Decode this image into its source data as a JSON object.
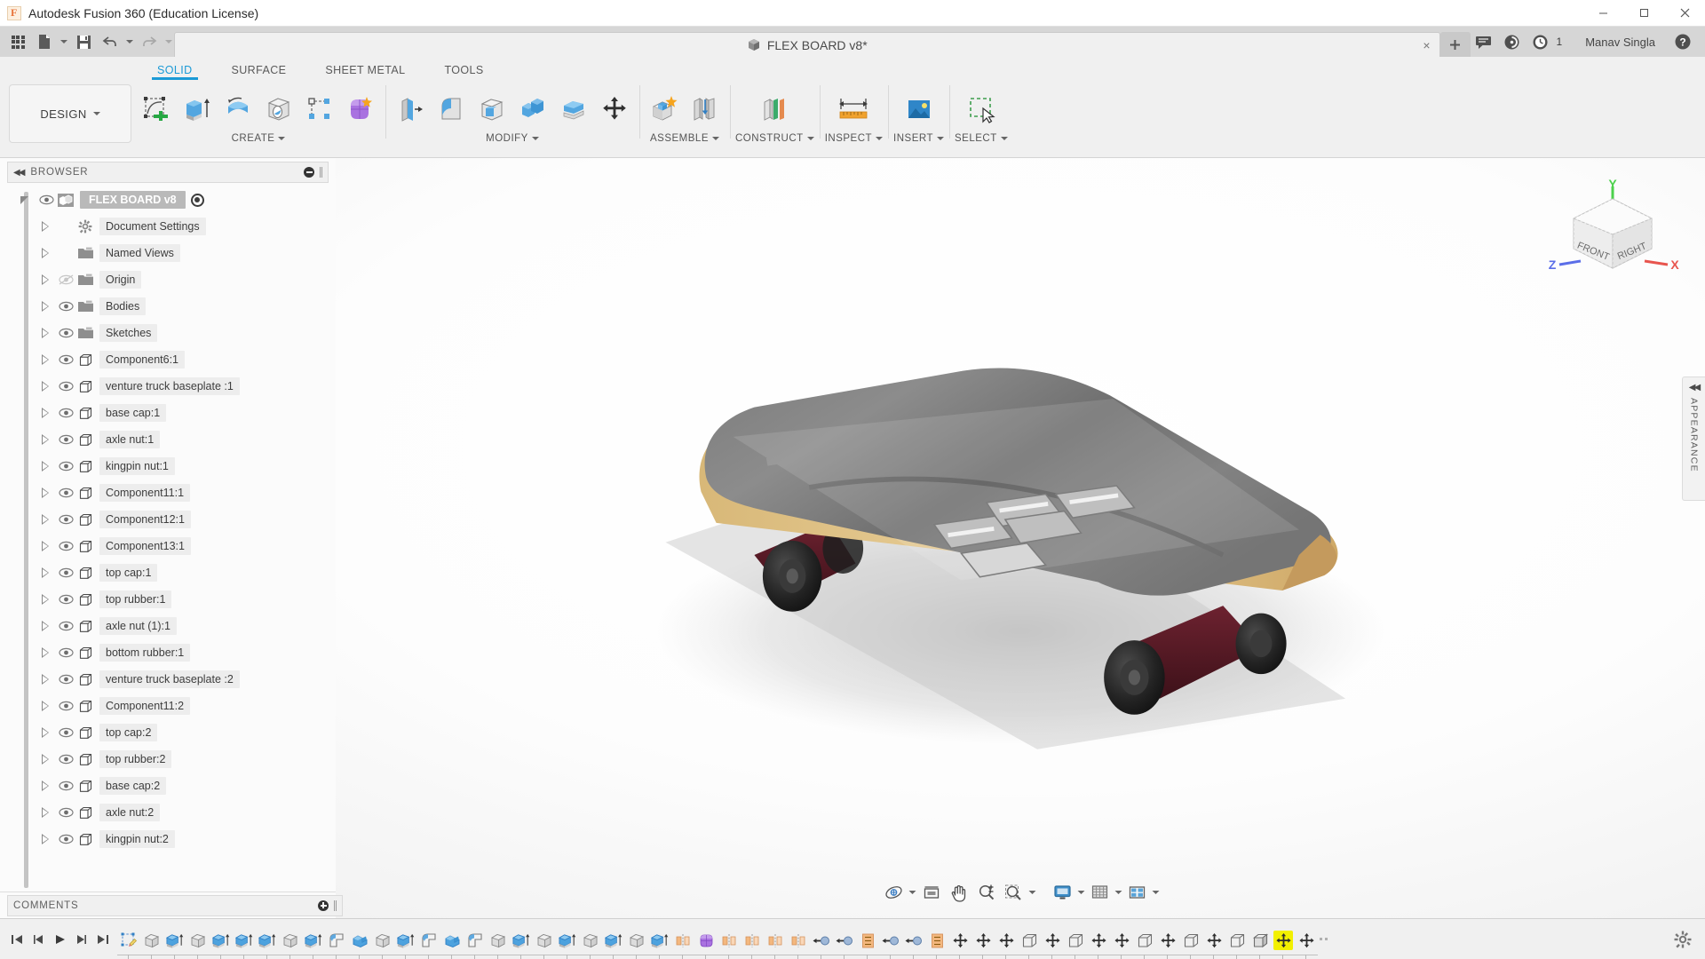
{
  "titlebar": {
    "app_title": "Autodesk Fusion 360 (Education License)",
    "app_icon": "fusion-logo-icon",
    "minimize": "minimize-icon",
    "maximize": "maximize-icon",
    "close": "close-icon"
  },
  "quickaccess": {
    "grid_label": "app-grid-icon",
    "new_label": "new-document-icon",
    "save_label": "save-icon",
    "undo_label": "undo-icon",
    "redo_label": "redo-icon",
    "tab_title": "FLEX BOARD v8*",
    "tab_icon": "component-cube-icon",
    "tab_close": "×",
    "new_tab": "+",
    "comment_icon": "comment-balloon-icon",
    "help_nav_icon": "notification-icon",
    "jobs_icon": "job-status-clock-icon",
    "jobs_count": "1",
    "username": "Manav Singla",
    "help_icon": "help-question-icon"
  },
  "ribbon": {
    "workspace": "DESIGN",
    "tabs": [
      {
        "label": "SOLID",
        "active": true
      },
      {
        "label": "SURFACE",
        "active": false
      },
      {
        "label": "SHEET METAL",
        "active": false
      },
      {
        "label": "TOOLS",
        "active": false
      }
    ],
    "groups": [
      {
        "label": "CREATE",
        "dropdown": true,
        "buttons": [
          "create-sketch-icon",
          "extrude-icon",
          "revolve-icon",
          "hole-icon",
          "rectangular-pattern-icon",
          "create-form-icon"
        ]
      },
      {
        "label": "MODIFY",
        "dropdown": true,
        "buttons": [
          "press-pull-icon",
          "fillet-icon",
          "shell-icon",
          "combine-icon",
          "offset-face-icon",
          "move-copy-icon"
        ]
      },
      {
        "label": "ASSEMBLE",
        "dropdown": true,
        "buttons": [
          "new-component-icon",
          "joint-icon"
        ]
      },
      {
        "label": "CONSTRUCT",
        "dropdown": true,
        "buttons": [
          "offset-plane-icon"
        ]
      },
      {
        "label": "INSPECT",
        "dropdown": true,
        "buttons": [
          "measure-icon"
        ]
      },
      {
        "label": "INSERT",
        "dropdown": true,
        "buttons": [
          "insert-canvas-icon"
        ]
      },
      {
        "label": "SELECT",
        "dropdown": true,
        "buttons": [
          "select-window-icon"
        ]
      }
    ]
  },
  "browser": {
    "title": "BROWSER",
    "collapse_icon": "collapse-left-icon",
    "minus_icon": "circle-minus-icon",
    "grip_icon": "panel-grip-icon",
    "root": {
      "label": "FLEX BOARD v8",
      "icon": "assembly-component-icon",
      "expanded": true,
      "visible": true,
      "activate_icon": "activate-target-icon"
    },
    "items": [
      {
        "label": "Document Settings",
        "icon": "gear-icon",
        "eye": "none"
      },
      {
        "label": "Named Views",
        "icon": "folder-icon",
        "eye": "none"
      },
      {
        "label": "Origin",
        "icon": "folder-icon",
        "eye": "hidden"
      },
      {
        "label": "Bodies",
        "icon": "folder-icon",
        "eye": "visible"
      },
      {
        "label": "Sketches",
        "icon": "folder-icon",
        "eye": "visible"
      },
      {
        "label": "Component6:1",
        "icon": "component-icon",
        "eye": "visible"
      },
      {
        "label": "venture truck baseplate :1",
        "icon": "component-icon",
        "eye": "visible"
      },
      {
        "label": "base cap:1",
        "icon": "component-icon",
        "eye": "visible"
      },
      {
        "label": "axle nut:1",
        "icon": "component-icon",
        "eye": "visible"
      },
      {
        "label": "kingpin nut:1",
        "icon": "component-icon",
        "eye": "visible"
      },
      {
        "label": "Component11:1",
        "icon": "component-icon",
        "eye": "visible"
      },
      {
        "label": "Component12:1",
        "icon": "component-icon",
        "eye": "visible"
      },
      {
        "label": "Component13:1",
        "icon": "component-icon",
        "eye": "visible"
      },
      {
        "label": "top cap:1",
        "icon": "component-icon",
        "eye": "visible"
      },
      {
        "label": "top rubber:1",
        "icon": "component-icon",
        "eye": "visible"
      },
      {
        "label": "axle nut (1):1",
        "icon": "component-icon",
        "eye": "visible"
      },
      {
        "label": "bottom rubber:1",
        "icon": "component-icon",
        "eye": "visible"
      },
      {
        "label": "venture truck baseplate :2",
        "icon": "component-icon",
        "eye": "visible"
      },
      {
        "label": "Component11:2",
        "icon": "component-icon",
        "eye": "visible"
      },
      {
        "label": "top cap:2",
        "icon": "component-icon",
        "eye": "visible"
      },
      {
        "label": "top rubber:2",
        "icon": "component-icon",
        "eye": "visible"
      },
      {
        "label": "base cap:2",
        "icon": "component-icon",
        "eye": "visible"
      },
      {
        "label": "axle nut:2",
        "icon": "component-icon",
        "eye": "visible"
      },
      {
        "label": "kingpin nut:2",
        "icon": "component-icon",
        "eye": "visible"
      }
    ]
  },
  "comments": {
    "title": "COMMENTS",
    "add_icon": "circle-plus-icon",
    "grip_icon": "panel-grip-icon"
  },
  "canvas": {
    "model_name": "skateboard-assembly",
    "viewcube": {
      "face_front": "FRONT",
      "face_right": "RIGHT",
      "axis_x": "X",
      "axis_y": "Y",
      "axis_z": "Z",
      "color_x": "#e8554e",
      "color_y": "#4cd14c",
      "color_z": "#5b6ee8"
    },
    "appearance_panel": {
      "label": "APPEARANCE",
      "collapse_icon": "collapse-left-icon"
    },
    "nav_toolbar": [
      {
        "name": "orbit-icon",
        "dropdown": true
      },
      {
        "name": "look-at-icon",
        "dropdown": false
      },
      {
        "name": "pan-hand-icon",
        "dropdown": false
      },
      {
        "name": "zoom-icon",
        "dropdown": false
      },
      {
        "name": "zoom-window-icon",
        "dropdown": true
      },
      {
        "name": "display-settings-icon",
        "dropdown": true
      },
      {
        "name": "grid-snaps-icon",
        "dropdown": true
      },
      {
        "name": "viewports-icon",
        "dropdown": true
      }
    ]
  },
  "timeline": {
    "playback": [
      "jump-to-beginning-icon",
      "step-back-icon",
      "play-icon",
      "step-forward-icon",
      "jump-to-end-icon"
    ],
    "settings_icon": "gear-icon",
    "features": [
      {
        "type": "sketch",
        "selected": false
      },
      {
        "type": "extrude-gray",
        "selected": false
      },
      {
        "type": "extrude-blue",
        "selected": false
      },
      {
        "type": "extrude-gray",
        "selected": false
      },
      {
        "type": "extrude-blue",
        "selected": false
      },
      {
        "type": "extrude-blue",
        "selected": false
      },
      {
        "type": "extrude-blue",
        "selected": false
      },
      {
        "type": "extrude-gray",
        "selected": false
      },
      {
        "type": "extrude-blue",
        "selected": false
      },
      {
        "type": "fillet",
        "selected": false
      },
      {
        "type": "combine",
        "selected": false
      },
      {
        "type": "extrude-gray",
        "selected": false
      },
      {
        "type": "extrude-blue",
        "selected": false
      },
      {
        "type": "fillet",
        "selected": false
      },
      {
        "type": "combine",
        "selected": false
      },
      {
        "type": "fillet",
        "selected": false
      },
      {
        "type": "extrude-gray",
        "selected": false
      },
      {
        "type": "extrude-blue",
        "selected": false
      },
      {
        "type": "extrude-gray",
        "selected": false
      },
      {
        "type": "extrude-blue",
        "selected": false
      },
      {
        "type": "extrude-gray",
        "selected": false
      },
      {
        "type": "extrude-blue",
        "selected": false
      },
      {
        "type": "extrude-gray",
        "selected": false
      },
      {
        "type": "extrude-blue",
        "selected": false
      },
      {
        "type": "mirror",
        "selected": false
      },
      {
        "type": "form",
        "selected": false
      },
      {
        "type": "mirror",
        "selected": false
      },
      {
        "type": "mirror",
        "selected": false
      },
      {
        "type": "mirror",
        "selected": false
      },
      {
        "type": "mirror",
        "selected": false
      },
      {
        "type": "joint",
        "selected": false
      },
      {
        "type": "joint",
        "selected": false
      },
      {
        "type": "as-built-joint",
        "selected": false
      },
      {
        "type": "joint",
        "selected": false
      },
      {
        "type": "joint",
        "selected": false
      },
      {
        "type": "as-built-joint",
        "selected": false
      },
      {
        "type": "move",
        "selected": false
      },
      {
        "type": "move",
        "selected": false
      },
      {
        "type": "move",
        "selected": false
      },
      {
        "type": "component",
        "selected": false
      },
      {
        "type": "move",
        "selected": false
      },
      {
        "type": "component",
        "selected": false
      },
      {
        "type": "move",
        "selected": false
      },
      {
        "type": "move",
        "selected": false
      },
      {
        "type": "component",
        "selected": false
      },
      {
        "type": "move",
        "selected": false
      },
      {
        "type": "component",
        "selected": false
      },
      {
        "type": "move",
        "selected": false
      },
      {
        "type": "component",
        "selected": false
      },
      {
        "type": "component-shaded",
        "selected": false
      },
      {
        "type": "move",
        "selected": true
      },
      {
        "type": "move",
        "selected": false
      }
    ]
  }
}
